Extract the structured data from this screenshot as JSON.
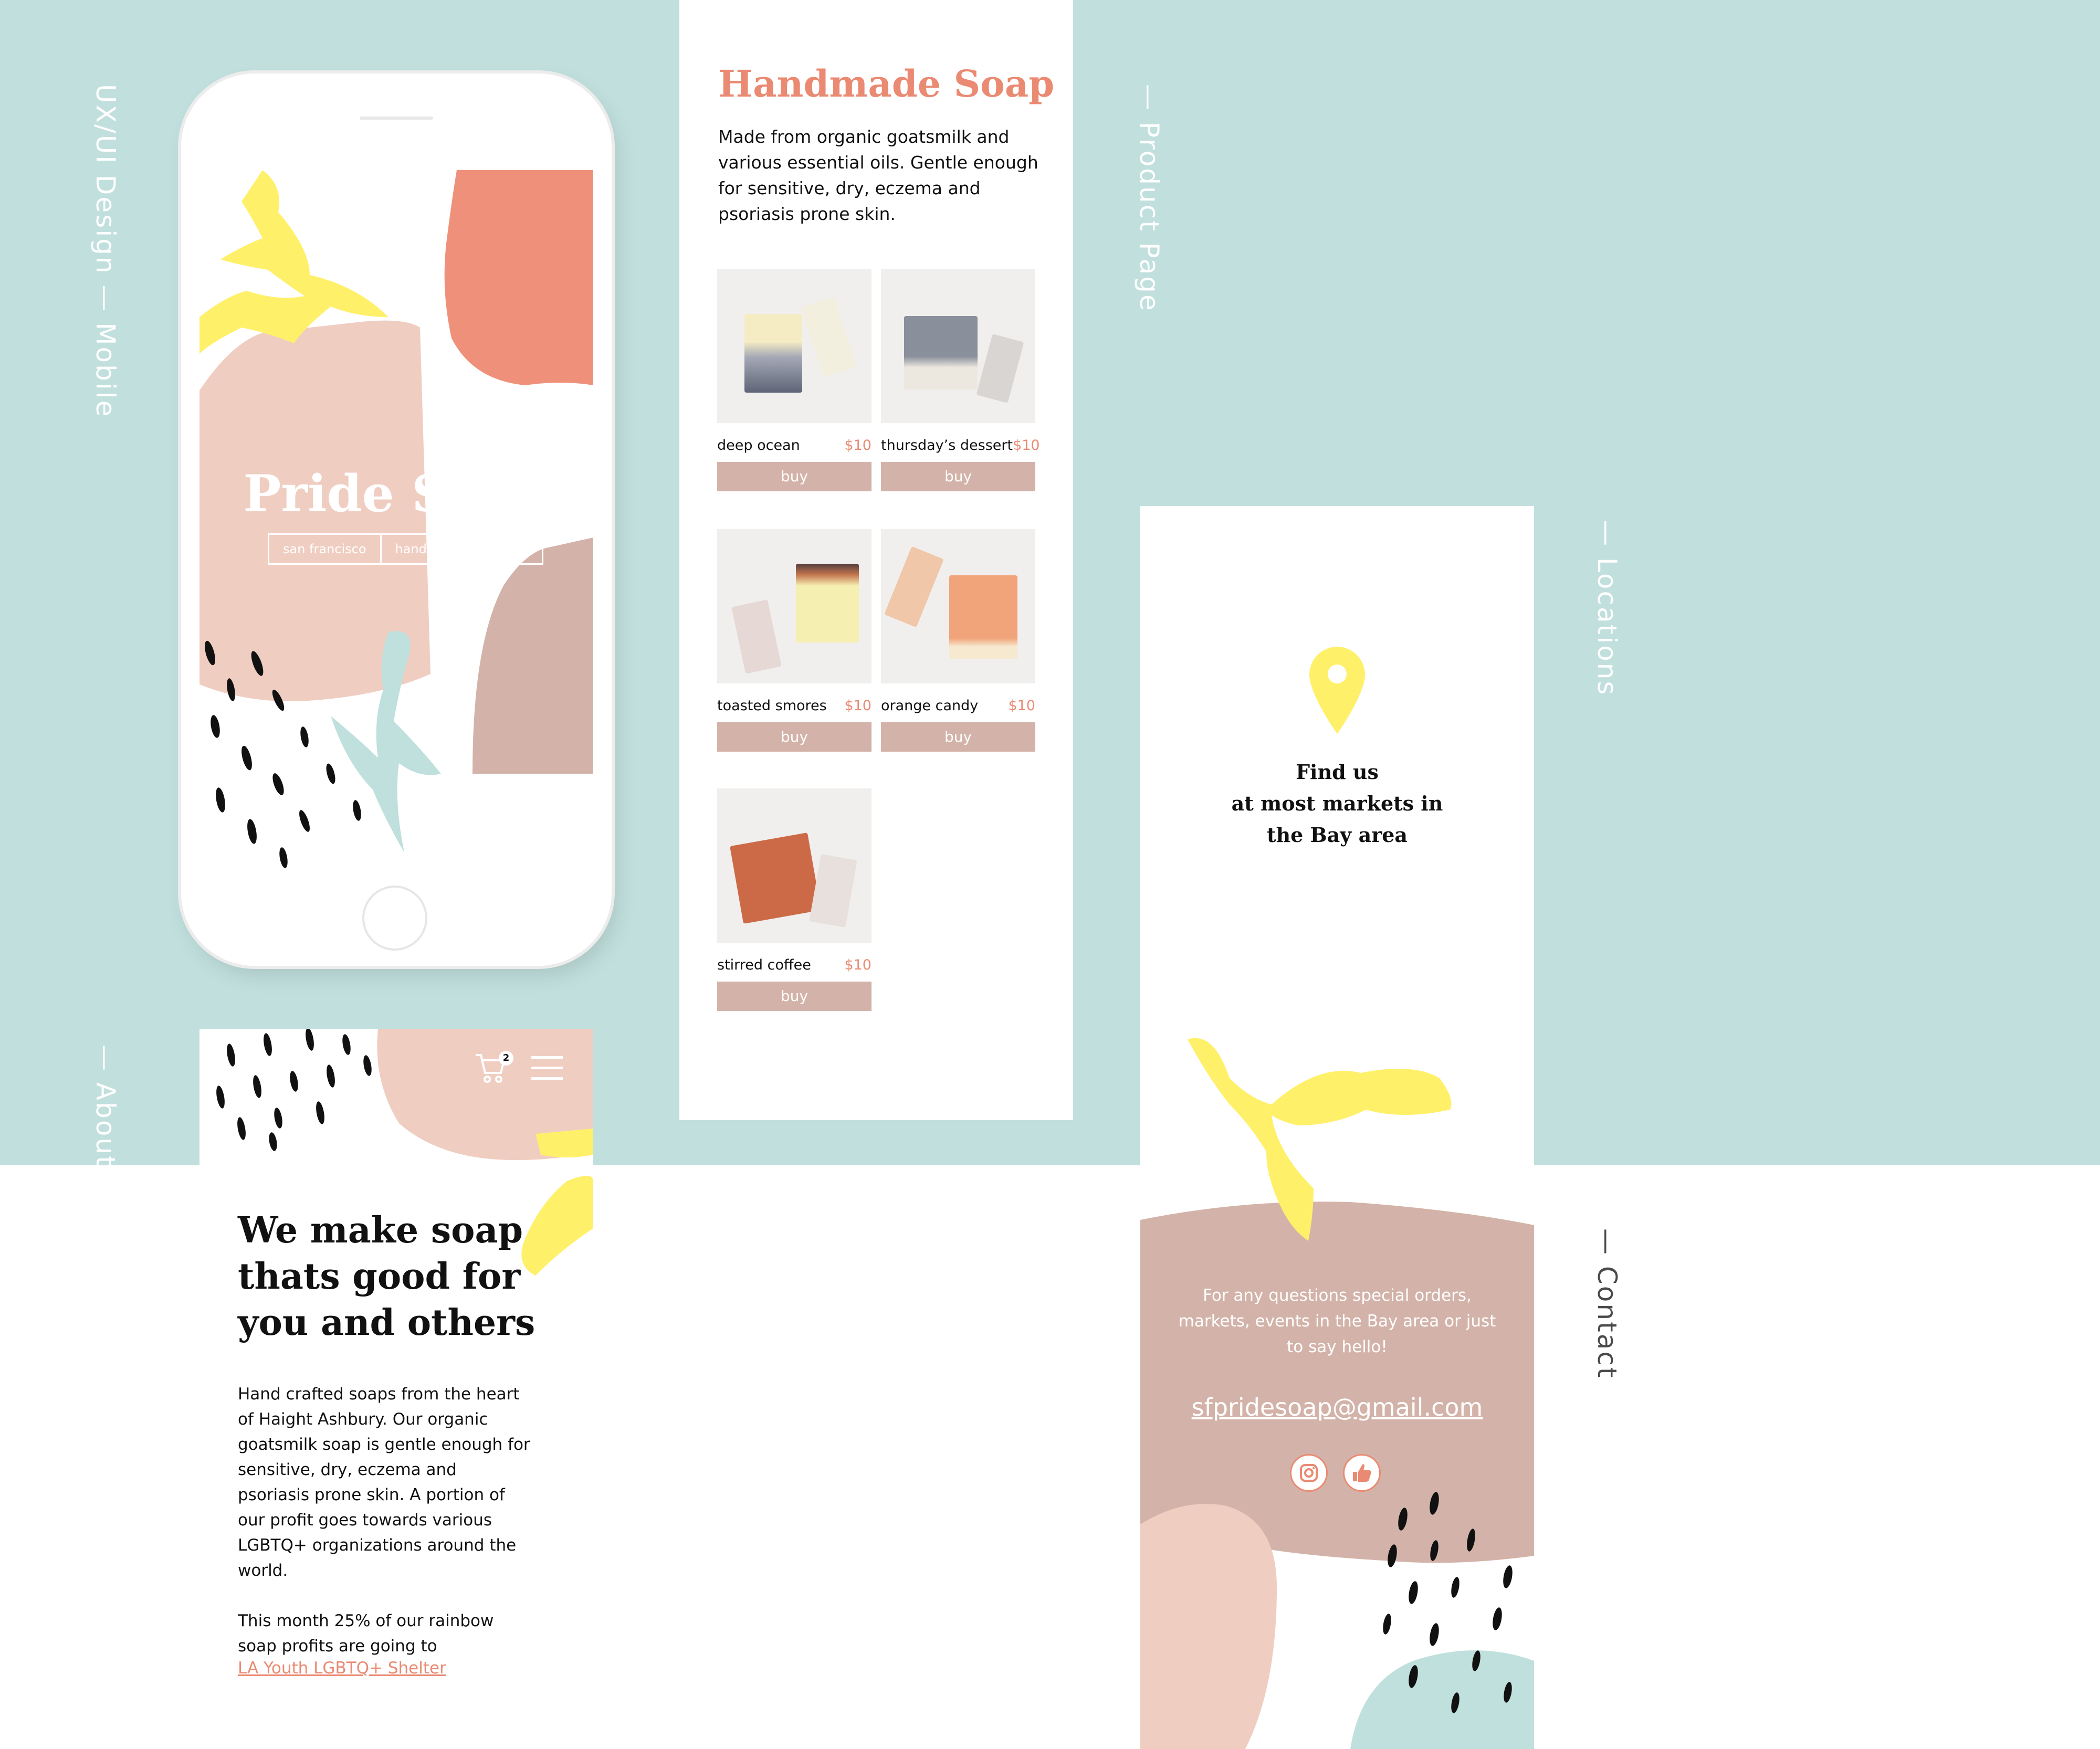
{
  "labels": {
    "ux": "UX/UI Design — Mobile",
    "product": "— Product Page",
    "locations": "— Locations",
    "about": "— About",
    "contact": "— Contact"
  },
  "hero": {
    "title": "Pride Soap",
    "tags": [
      "san francisco",
      "handmade goatsmilk"
    ]
  },
  "product_page": {
    "title": "Handmade Soap",
    "description": "Made from organic goatsmilk and various essential oils. Gentle enough for sensitive, dry, eczema and psoriasis prone skin.",
    "products": [
      {
        "name": "deep ocean",
        "price": "$10",
        "buy": "buy"
      },
      {
        "name": "thursday’s dessert",
        "price": "$10",
        "buy": "buy"
      },
      {
        "name": "toasted smores",
        "price": "$10",
        "buy": "buy"
      },
      {
        "name": "orange candy",
        "price": "$10",
        "buy": "buy"
      },
      {
        "name": "stirred coffee",
        "price": "$10",
        "buy": "buy"
      }
    ]
  },
  "locations": {
    "find_us_1": "Find us",
    "find_us_2": "at most markets in",
    "find_us_3": "the Bay area"
  },
  "contact": {
    "text": "For any questions special orders, markets, events in the Bay area or just to say hello!",
    "email": "sfpridesoap@gmail.com",
    "icons": [
      "instagram-icon",
      "thumbs-up-icon"
    ]
  },
  "about": {
    "cart_count": "2",
    "title": "We make soap thats good for you and others",
    "body": "Hand crafted soaps from the heart of Haight Ashbury. Our organic goatsmilk soap is gentle enough for sensitive, dry, eczema and psoriasis prone skin. A portion of our profit goes towards various LGBTQ+ organizations around the world.",
    "p2": "This month 25% of our rainbow soap profits are going to",
    "link": "LA Youth LGBTQ+ Shelter"
  },
  "colors": {
    "teal": "#c1e0dd",
    "coral": "#ea8a72",
    "blush": "#f0cdc1",
    "mauve": "#d3b3a9",
    "yellow": "#fff06a"
  }
}
